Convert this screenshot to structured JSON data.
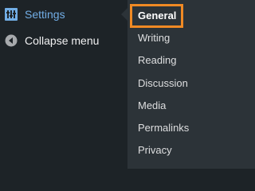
{
  "menu": {
    "items": [
      {
        "label": "Settings",
        "icon": "settings-sliders-icon",
        "active": true
      },
      {
        "label": "Collapse menu",
        "icon": "collapse-arrow-icon"
      }
    ]
  },
  "submenu": {
    "items": [
      {
        "label": "General",
        "current": true
      },
      {
        "label": "Writing"
      },
      {
        "label": "Reading"
      },
      {
        "label": "Discussion"
      },
      {
        "label": "Media"
      },
      {
        "label": "Permalinks"
      },
      {
        "label": "Privacy"
      }
    ]
  },
  "colors": {
    "menu_background": "#1d2327",
    "submenu_background": "#2c3338",
    "active_text": "#72aee6",
    "highlight_box": "#f08a24"
  }
}
